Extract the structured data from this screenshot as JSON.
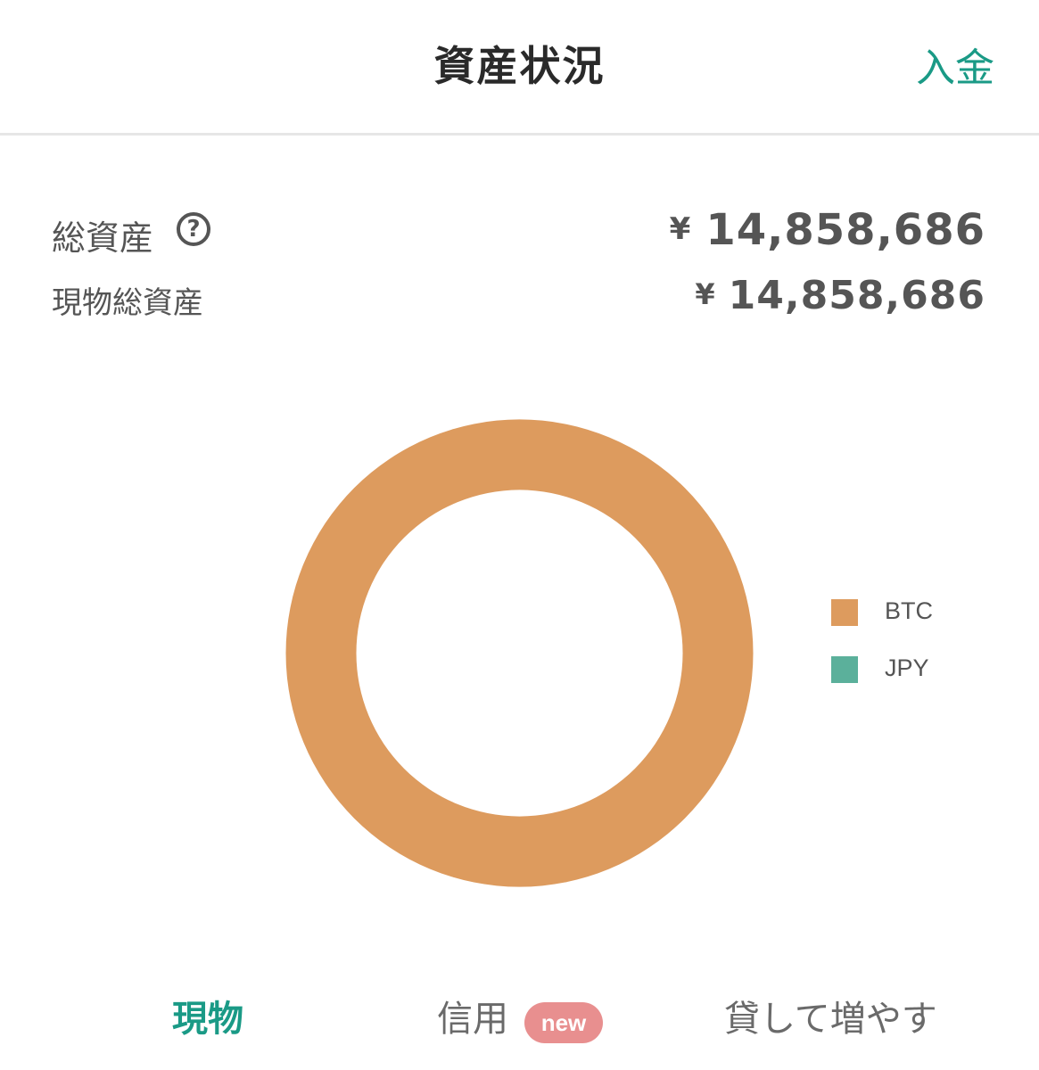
{
  "header": {
    "title": "資産状況",
    "deposit_label": "入金"
  },
  "summary": {
    "total_label": "総資産",
    "help_icon_glyph": "?",
    "currency_symbol": "¥",
    "total_value": "14,858,686",
    "spot_label": "現物総資産",
    "spot_value": "14,858,686"
  },
  "chart_data": {
    "type": "pie",
    "style": "donut",
    "title": "",
    "legend_position": "right",
    "categories": [
      "BTC",
      "JPY"
    ],
    "values": [
      100,
      0
    ],
    "colors": [
      "#dd9b5e",
      "#5bb09b"
    ]
  },
  "tabs": [
    {
      "label": "現物",
      "active": true
    },
    {
      "label": "信用",
      "active": false,
      "badge": "new"
    },
    {
      "label": "貸して増やす",
      "active": false
    }
  ],
  "colors": {
    "accent": "#1a9a86",
    "badge": "#e88f8f"
  },
  "icons": [
    "help-circle-icon"
  ]
}
